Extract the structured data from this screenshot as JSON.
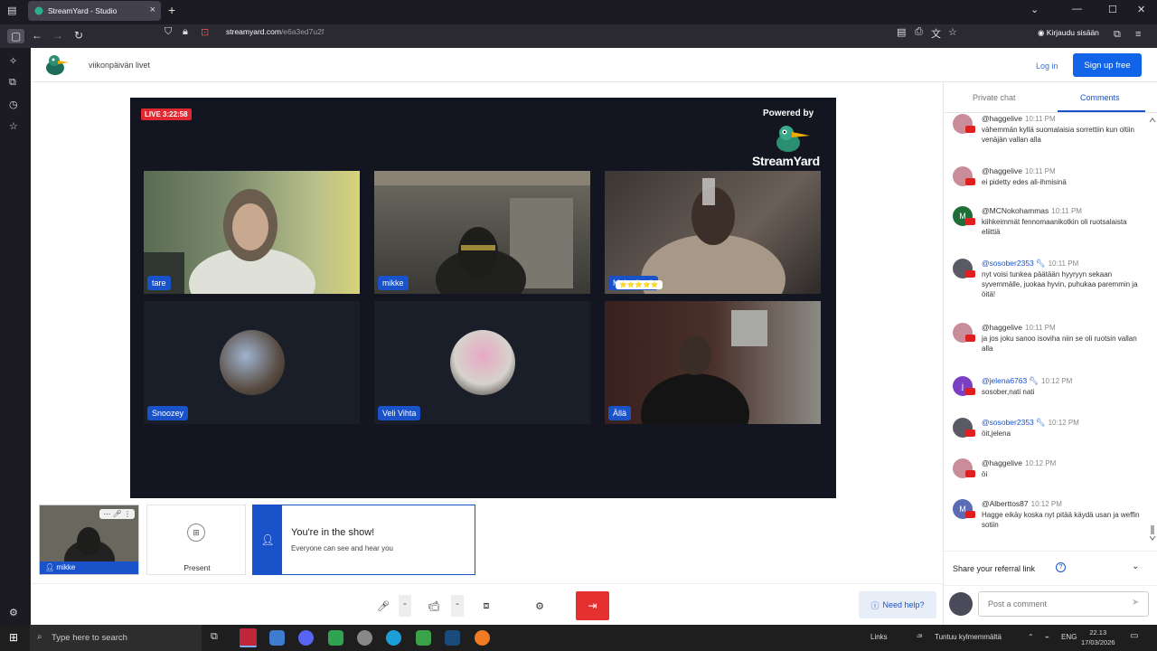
{
  "browser": {
    "tab_title": "StreamYard - Studio",
    "url_host": "streamyard.com",
    "url_path": "/e6a3ed7u2f",
    "account_label": "Kirjaudu sisään"
  },
  "header": {
    "studio_name": "viikonpäivän livet",
    "login_label": "Log in",
    "signup_label": "Sign up free"
  },
  "stage": {
    "live_label": "LIVE 3:22:58",
    "powered_by": "Powered by",
    "brand": "StreamYard",
    "participants": [
      {
        "name": "tare"
      },
      {
        "name": "mikke"
      },
      {
        "name": "Maja-töpsä",
        "badge": "⭐⭐⭐⭐⭐"
      },
      {
        "name": "Snoozey"
      },
      {
        "name": "Veli Vihta"
      },
      {
        "name": "Ällä"
      }
    ]
  },
  "bottom": {
    "self_name": "mikke",
    "present_label": "Present",
    "inshow_title": "You're in the show!",
    "inshow_sub": "Everyone can see and hear you",
    "help_label": "Need help?"
  },
  "chat": {
    "tab_private": "Private chat",
    "tab_comments": "Comments",
    "messages": [
      {
        "user": "@haggelive",
        "time": "10:11 PM",
        "text": "vähemmän kyllä suomalaisia sorrettiin kun oltiin venäjän vallan alla",
        "avatar_color": "#c98d9a",
        "avatar_letter": ""
      },
      {
        "user": "@haggelive",
        "time": "10:11 PM",
        "text": "ei pidetty edes ali-ihmisinä",
        "avatar_color": "#c98d9a",
        "avatar_letter": ""
      },
      {
        "user": "@MCNokohammas",
        "time": "10:11 PM",
        "text": "kiihkeimmät fennomaanikotkin oli ruotsalaista eliittiä",
        "avatar_color": "#1e6e3a",
        "avatar_letter": "M"
      },
      {
        "user": "@sosober2353",
        "time": "10:11 PM",
        "text": "nyt voisi tunkea päätään hyyryyn sekaan syvemmälle, juokaa hyvin, puhukaa paremmin ja öitä!",
        "avatar_color": "#5a5a66",
        "avatar_letter": "",
        "moderator": true
      },
      {
        "user": "@haggelive",
        "time": "10:11 PM",
        "text": "ja jos joku sanoo isoviha niin se oli ruotsin vallan alla",
        "avatar_color": "#c98d9a",
        "avatar_letter": ""
      },
      {
        "user": "@jelena6763",
        "time": "10:12 PM",
        "text": "sosober,nati nati",
        "avatar_color": "#7b3fc4",
        "avatar_letter": "j",
        "moderator": true
      },
      {
        "user": "@sosober2353",
        "time": "10:12 PM",
        "text": "öit,jelena",
        "avatar_color": "#5a5a66",
        "avatar_letter": "",
        "moderator": true
      },
      {
        "user": "@haggelive",
        "time": "10:12 PM",
        "text": "öi",
        "avatar_color": "#c98d9a",
        "avatar_letter": ""
      },
      {
        "user": "@Alberttos87",
        "time": "10:12 PM",
        "text": "Hagge eikäy koska nyt pitää käydä usan ja weffin sotiin",
        "avatar_color": "#5b6bb5",
        "avatar_letter": "M"
      }
    ],
    "referral_label": "Share your referral link",
    "comment_placeholder": "Post a comment"
  },
  "taskbar": {
    "search_placeholder": "Type here to search",
    "links_label": "Links",
    "weather": "Tuntuu kylmemmältä",
    "lang": "ENG",
    "time": "22.13",
    "date": "17/03/2026"
  },
  "colors": {
    "accent": "#1a52c9",
    "signup": "#1163e8",
    "live": "#e02830",
    "leave": "#e53030"
  }
}
